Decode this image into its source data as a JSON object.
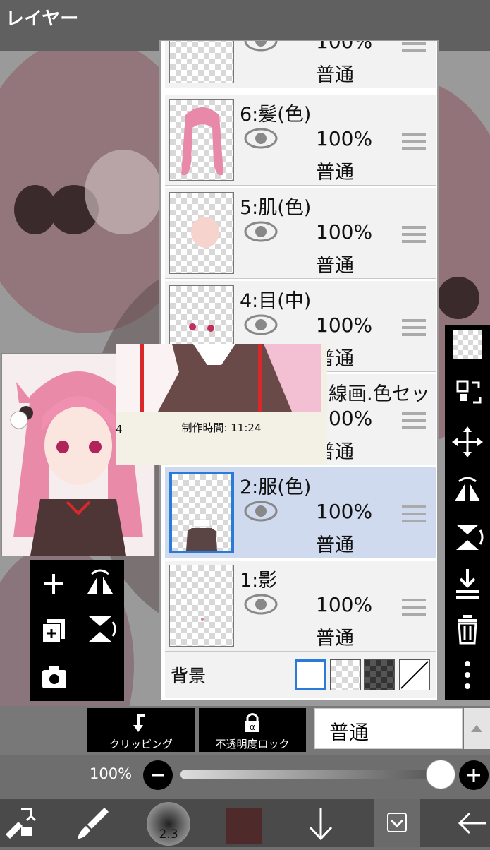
{
  "header": {
    "title": "レイヤー"
  },
  "layers": [
    {
      "name": "",
      "opacity": "100%",
      "blend": "普通",
      "selected": false
    },
    {
      "name": "6:髪(色)",
      "opacity": "100%",
      "blend": "普通",
      "selected": false
    },
    {
      "name": "5:肌(色)",
      "opacity": "100%",
      "blend": "普通",
      "selected": false
    },
    {
      "name": "4:目(中)",
      "opacity": "100%",
      "blend": "普通",
      "selected": false
    },
    {
      "name": "線画.色セッ",
      "opacity": "00%",
      "blend": "普通",
      "selected": false
    },
    {
      "name": "2:服(色)",
      "opacity": "100%",
      "blend": "普通",
      "selected": true
    },
    {
      "name": "1:影",
      "opacity": "100%",
      "blend": "普通",
      "selected": false
    }
  ],
  "background": {
    "label": "背景"
  },
  "tooltip": {
    "time_text": "制作時間:  11:24",
    "partial_digit": "4"
  },
  "action_bar": {
    "clipping_label": "クリッピング",
    "alpha_lock_label": "不透明度ロック",
    "blend_mode": "普通"
  },
  "opacity_slider": {
    "label": "100%",
    "value": 1.0
  },
  "bottom_bar": {
    "brush_size": "2.3",
    "color": "#4e2a2a"
  },
  "colors": {
    "selected_row": "#cfdaee",
    "selected_border": "#2a7ad9",
    "accent_red": "#d8282a"
  }
}
